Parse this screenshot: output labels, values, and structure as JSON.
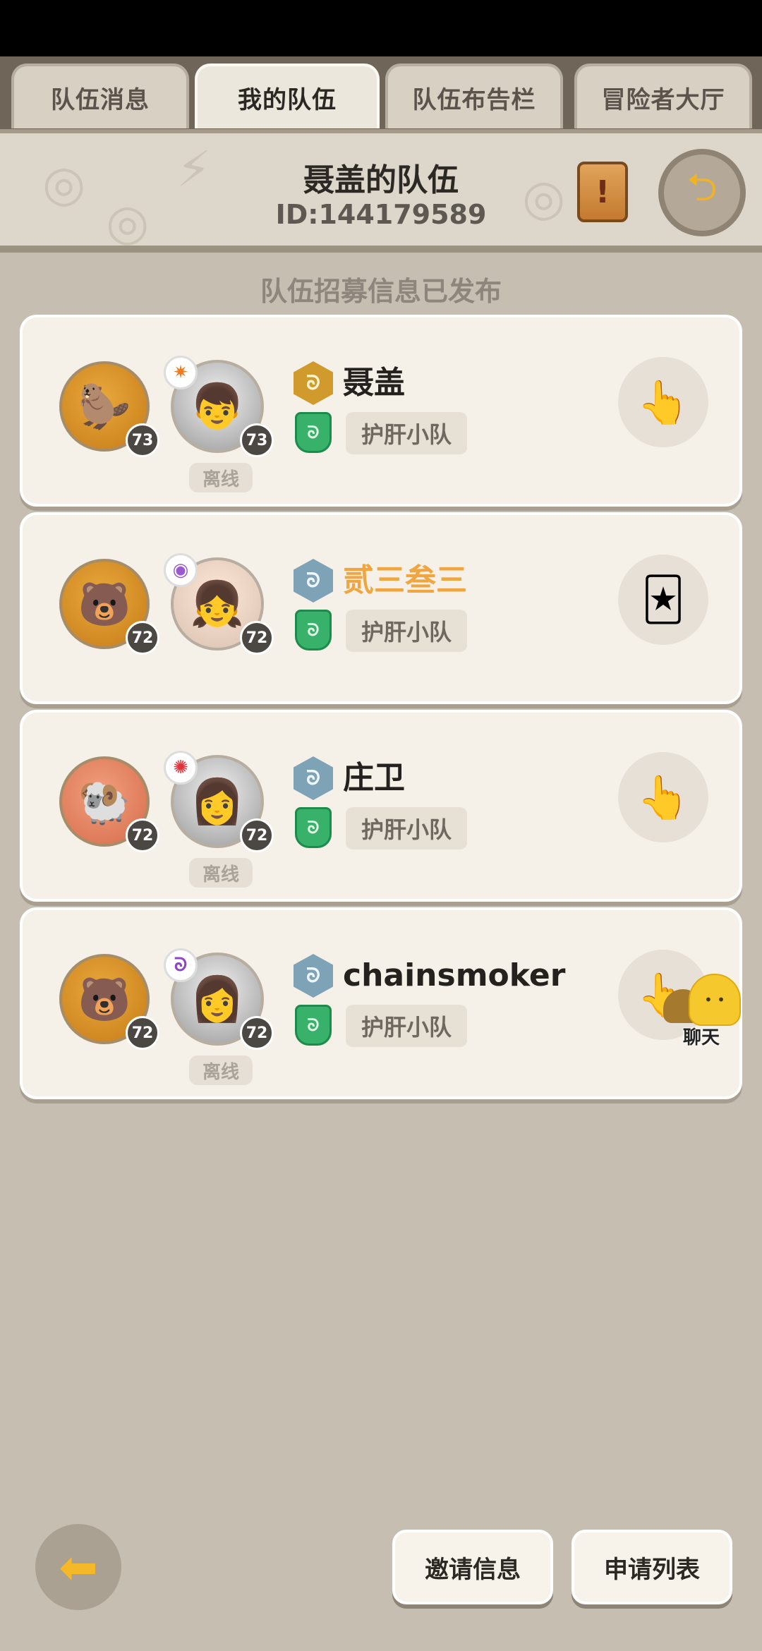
{
  "tabs": [
    {
      "label": "队伍消息",
      "active": false
    },
    {
      "label": "我的队伍",
      "active": true
    },
    {
      "label": "队伍布告栏",
      "active": false
    },
    {
      "label": "冒险者大厅",
      "active": false
    }
  ],
  "header": {
    "team_name": "聂盖的队伍",
    "team_id": "ID:144179589",
    "notice_icon": "scroll-notice-icon",
    "exit_icon": "exit-team-icon"
  },
  "recruit_status": "队伍招募信息已发布",
  "members": [
    {
      "pet_level": "73",
      "avatar_level": "73",
      "name": "聂盖",
      "guild": "护肝小队",
      "status": "离线",
      "rank": "gold",
      "element": "fire",
      "action_icon": "gesture-icon"
    },
    {
      "pet_level": "72",
      "avatar_level": "72",
      "name": "贰三叁三",
      "guild": "护肝小队",
      "status": "",
      "rank": "silver",
      "element": "psychic",
      "action_icon": "card-gesture-icon"
    },
    {
      "pet_level": "72",
      "avatar_level": "72",
      "name": "庄卫",
      "guild": "护肝小队",
      "status": "离线",
      "rank": "silver",
      "element": "fire-red",
      "action_icon": "gesture-icon"
    },
    {
      "pet_level": "72",
      "avatar_level": "72",
      "name": "chainsmoker",
      "guild": "护肝小队",
      "status": "离线",
      "rank": "silver",
      "element": "wind",
      "action_icon": "gesture-icon"
    }
  ],
  "chat": {
    "label": "聊天"
  },
  "footer": {
    "invite_label": "邀请信息",
    "apply_label": "申请列表",
    "back_icon": "back-arrow-icon"
  },
  "colors": {
    "highlight_name": "#f0a640",
    "background": "#c7beb2",
    "card": "#f5f1e9"
  }
}
